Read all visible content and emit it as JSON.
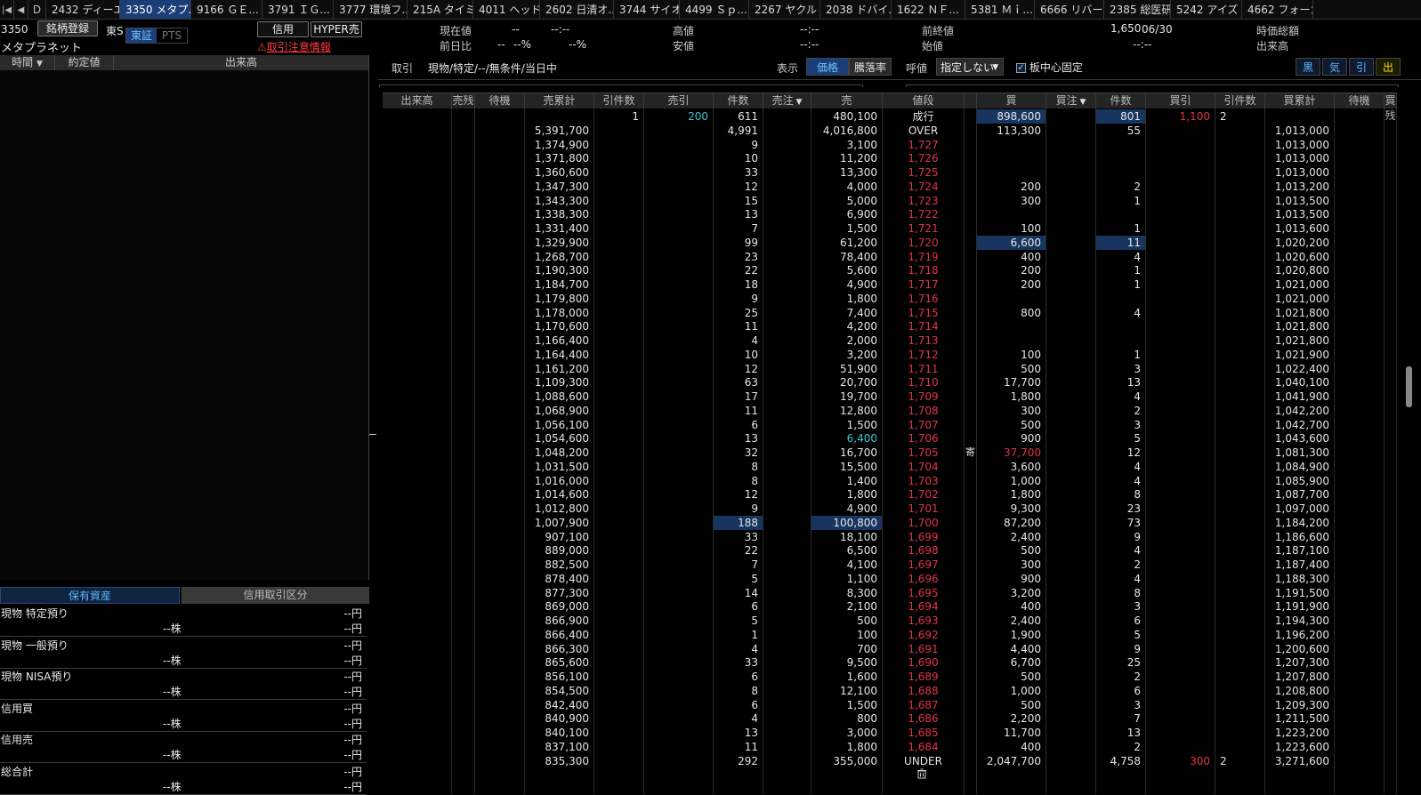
{
  "tabs": [
    "2432 ディーエ...",
    "3350 メタプ...",
    "9166 ＧＥ...",
    "3791 ＩＧ...",
    "3777 環境フ...",
    "215A タイミー",
    "4011 ヘッド...",
    "2602 日清オ...",
    "3744 サイオス",
    "4499 Ｓｐ...",
    "2267 ヤクルト",
    "2038 ドバイ...",
    "1622 ＮＦ...",
    "5381 Ｍｉ...",
    "6666 リバー...",
    "2385 総医研",
    "5242 アイズ",
    "4662 フォーカ..."
  ],
  "active_tab": 1,
  "nav": {
    "first": "|◀",
    "prev": "◀",
    "d": "D"
  },
  "stock": {
    "code": "3350",
    "name": "メタプラネット",
    "register_btn": "銘柄登録",
    "market": "東S",
    "exch_tse": "東証",
    "exch_pts": "PTS",
    "margin_btn": "信用",
    "hyper_btn": "HYPER売",
    "warning": "取引注意情報"
  },
  "quote": {
    "cur_label": "現在値",
    "cur_val": "--",
    "cur_time": "--:--",
    "prev_label": "前日比",
    "prev_val": "--",
    "prev_pct1": "--%",
    "prev_pct2": "--%",
    "high_label": "高値",
    "high_val": "--:--",
    "low_label": "安値",
    "low_val": "--:--",
    "close_label": "前終値",
    "close_val": "1,650",
    "close_date": "06/30",
    "open_label": "始値",
    "open_val": "--:--",
    "mcap_label": "時価総額",
    "vol_label": "出来高"
  },
  "left": {
    "cols": [
      "時間",
      "約定値",
      "出来高"
    ],
    "tab_assets": "保有資産",
    "tab_margin": "信用取引区分",
    "assets": [
      {
        "label": "現物 特定預り",
        "yen": "--円",
        "shares": "--株",
        "yen2": "--円"
      },
      {
        "label": "現物 一般預り",
        "yen": "--円",
        "shares": "--株",
        "yen2": "--円"
      },
      {
        "label": "現物 NISA預り",
        "yen": "--円",
        "shares": "--株",
        "yen2": "--円"
      },
      {
        "label": "信用買",
        "yen": "--円",
        "shares": "--株",
        "yen2": "--円"
      },
      {
        "label": "信用売",
        "yen": "--円",
        "shares": "--株",
        "yen2": "--円"
      },
      {
        "label": "総合計",
        "yen": "--円",
        "shares": "--株",
        "yen2": "--円"
      }
    ]
  },
  "toolbar": {
    "trade_label": "取引",
    "trade_value": "現物/特定/--/無条件/当日中",
    "display_label": "表示",
    "price_btn": "価格",
    "rate_btn": "騰落率",
    "tick_label": "呼値",
    "tick_value": "指定しない",
    "fix_center": "板中心固定",
    "b_kuro": "黒",
    "b_ki": "気",
    "b_hiki": "引",
    "b_de": "出"
  },
  "book": {
    "headers": [
      "出来高",
      "売残",
      "待機",
      "売累計",
      "引件数",
      "売引",
      "件数",
      "売注",
      "売",
      "値段",
      "",
      "買",
      "買注",
      "件数",
      "買引",
      "引件数",
      "買累計",
      "待機",
      "買残"
    ],
    "top": {
      "hiki_count": "1",
      "sell_hiki": "200",
      "count": "611",
      "sell": "480,100",
      "price": "成行",
      "buy": "898,600",
      "buy_count": "801",
      "buy_hiki": "1,100",
      "buy_hiki_count": "2"
    },
    "over": {
      "cum": "5,391,700",
      "count": "4,991",
      "sell": "4,016,800",
      "price": "OVER",
      "buy": "113,300",
      "buy_count": "55",
      "buy_cum": "1,013,000"
    },
    "rows": [
      [
        "1,374,900",
        "9",
        "3,100",
        "1,727",
        "",
        "",
        "1,013,000"
      ],
      [
        "1,371,800",
        "10",
        "11,200",
        "1,726",
        "",
        "",
        "1,013,000"
      ],
      [
        "1,360,600",
        "33",
        "13,300",
        "1,725",
        "",
        "",
        "1,013,000"
      ],
      [
        "1,347,300",
        "12",
        "4,000",
        "1,724",
        "200",
        "2",
        "1,013,200"
      ],
      [
        "1,343,300",
        "15",
        "5,000",
        "1,723",
        "300",
        "1",
        "1,013,500"
      ],
      [
        "1,338,300",
        "13",
        "6,900",
        "1,722",
        "",
        "",
        "1,013,500"
      ],
      [
        "1,331,400",
        "7",
        "1,500",
        "1,721",
        "100",
        "1",
        "1,013,600"
      ],
      [
        "1,329,900",
        "99",
        "61,200",
        "1,720",
        "6,600",
        "11",
        "1,020,200"
      ],
      [
        "1,268,700",
        "23",
        "78,400",
        "1,719",
        "400",
        "4",
        "1,020,600"
      ],
      [
        "1,190,300",
        "22",
        "5,600",
        "1,718",
        "200",
        "1",
        "1,020,800"
      ],
      [
        "1,184,700",
        "18",
        "4,900",
        "1,717",
        "200",
        "1",
        "1,021,000"
      ],
      [
        "1,179,800",
        "9",
        "1,800",
        "1,716",
        "",
        "",
        "1,021,000"
      ],
      [
        "1,178,000",
        "25",
        "7,400",
        "1,715",
        "800",
        "4",
        "1,021,800"
      ],
      [
        "1,170,600",
        "11",
        "4,200",
        "1,714",
        "",
        "",
        "1,021,800"
      ],
      [
        "1,166,400",
        "4",
        "2,000",
        "1,713",
        "",
        "",
        "1,021,800"
      ],
      [
        "1,164,400",
        "10",
        "3,200",
        "1,712",
        "100",
        "1",
        "1,021,900"
      ],
      [
        "1,161,200",
        "12",
        "51,900",
        "1,711",
        "500",
        "3",
        "1,022,400"
      ],
      [
        "1,109,300",
        "63",
        "20,700",
        "1,710",
        "17,700",
        "13",
        "1,040,100"
      ],
      [
        "1,088,600",
        "17",
        "19,700",
        "1,709",
        "1,800",
        "4",
        "1,041,900"
      ],
      [
        "1,068,900",
        "11",
        "12,800",
        "1,708",
        "300",
        "2",
        "1,042,200"
      ],
      [
        "1,056,100",
        "6",
        "1,500",
        "1,707",
        "500",
        "3",
        "1,042,700"
      ],
      [
        "1,054,600",
        "13",
        "6,400",
        "1,706",
        "900",
        "5",
        "1,043,600"
      ],
      [
        "1,048,200",
        "32",
        "16,700",
        "1,705",
        "37,700",
        "12",
        "1,081,300"
      ],
      [
        "1,031,500",
        "8",
        "15,500",
        "1,704",
        "3,600",
        "4",
        "1,084,900"
      ],
      [
        "1,016,000",
        "8",
        "1,400",
        "1,703",
        "1,000",
        "4",
        "1,085,900"
      ],
      [
        "1,014,600",
        "12",
        "1,800",
        "1,702",
        "1,800",
        "8",
        "1,087,700"
      ],
      [
        "1,012,800",
        "9",
        "4,900",
        "1,701",
        "9,300",
        "23",
        "1,097,000"
      ],
      [
        "1,007,900",
        "188",
        "100,800",
        "1,700",
        "87,200",
        "73",
        "1,184,200"
      ],
      [
        "907,100",
        "33",
        "18,100",
        "1,699",
        "2,400",
        "9",
        "1,186,600"
      ],
      [
        "889,000",
        "22",
        "6,500",
        "1,698",
        "500",
        "4",
        "1,187,100"
      ],
      [
        "882,500",
        "7",
        "4,100",
        "1,697",
        "300",
        "2",
        "1,187,400"
      ],
      [
        "878,400",
        "5",
        "1,100",
        "1,696",
        "900",
        "4",
        "1,188,300"
      ],
      [
        "877,300",
        "14",
        "8,300",
        "1,695",
        "3,200",
        "8",
        "1,191,500"
      ],
      [
        "869,000",
        "6",
        "2,100",
        "1,694",
        "400",
        "3",
        "1,191,900"
      ],
      [
        "866,900",
        "5",
        "500",
        "1,693",
        "2,400",
        "6",
        "1,194,300"
      ],
      [
        "866,400",
        "1",
        "100",
        "1,692",
        "1,900",
        "5",
        "1,196,200"
      ],
      [
        "866,300",
        "4",
        "700",
        "1,691",
        "4,400",
        "9",
        "1,200,600"
      ],
      [
        "865,600",
        "33",
        "9,500",
        "1,690",
        "6,700",
        "25",
        "1,207,300"
      ],
      [
        "856,100",
        "6",
        "1,600",
        "1,689",
        "500",
        "2",
        "1,207,800"
      ],
      [
        "854,500",
        "8",
        "12,100",
        "1,688",
        "1,000",
        "6",
        "1,208,800"
      ],
      [
        "842,400",
        "6",
        "1,500",
        "1,687",
        "500",
        "3",
        "1,209,300"
      ],
      [
        "840,900",
        "4",
        "800",
        "1,686",
        "2,200",
        "7",
        "1,211,500"
      ],
      [
        "840,100",
        "13",
        "3,000",
        "1,685",
        "11,700",
        "13",
        "1,223,200"
      ],
      [
        "837,100",
        "11",
        "1,800",
        "1,684",
        "400",
        "2",
        "1,223,600"
      ]
    ],
    "under": {
      "cum": "835,300",
      "count": "292",
      "sell": "355,000",
      "price": "UNDER",
      "buy": "2,047,700",
      "buy_count": "4,758",
      "buy_hiki": "300",
      "buy_hiki_count": "2",
      "buy_cum": "3,271,600"
    },
    "marker_yori": "寄",
    "trash_icon": "trash-icon"
  },
  "colors": {
    "accent": "#1b3e78",
    "price_red": "#e0324a",
    "highlight": "#17355f",
    "cyan": "#39c6d4"
  }
}
